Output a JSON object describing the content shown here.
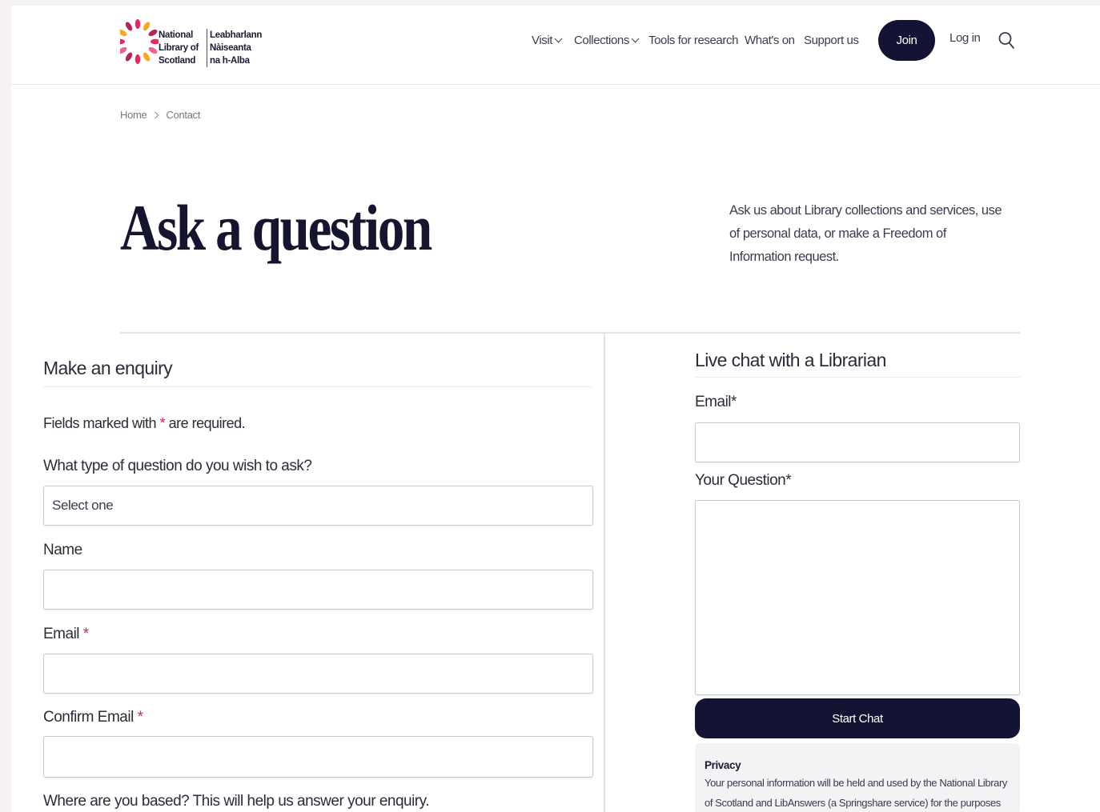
{
  "header": {
    "logo": {
      "en_lines": [
        "National",
        "Library of",
        "Scotland"
      ],
      "gd_lines": [
        "Leabharlann",
        "Nàiseanta",
        "na h-Alba"
      ]
    },
    "nav": [
      {
        "label": "Visit",
        "has_dropdown": true
      },
      {
        "label": "Collections",
        "has_dropdown": true
      },
      {
        "label": "Tools for research",
        "has_dropdown": false
      },
      {
        "label": "What's on",
        "has_dropdown": false
      },
      {
        "label": "Support us",
        "has_dropdown": false
      }
    ],
    "join_label": "Join",
    "login_label": "Log in",
    "search_icon": "search-icon"
  },
  "breadcrumb": {
    "home": "Home",
    "current": "Contact"
  },
  "hero": {
    "title": "Ask a question",
    "intro": "Ask us about Library collections and services, use of personal data, or make a Freedom of Information request."
  },
  "enquiry": {
    "title": "Make an enquiry",
    "required_note_before": "Fields marked with",
    "required_marker": "*",
    "required_note_after": "are required.",
    "question_type_label": "What type of question do you wish to ask?",
    "question_type_value": "Select one",
    "name_label": "Name",
    "name_value": "",
    "email_label": "Email",
    "email_value": "",
    "confirm_email_label": "Confirm Email",
    "confirm_email_value": "",
    "location_label": "Where are you based? This will help us answer your enquiry."
  },
  "livechat": {
    "title": "Live chat with a Librarian",
    "email_label": "Email",
    "email_value": "",
    "question_label": "Your Question",
    "question_value": "",
    "start_label": "Start Chat",
    "privacy_title": "Privacy",
    "privacy_text": "Your personal information will be held and used by the National Library of Scotland and LibAnswers (a Springshare service) for the purposes of"
  },
  "colors": {
    "navy": "#131433",
    "required": "#d6224e",
    "background": "#f6f1f3"
  }
}
